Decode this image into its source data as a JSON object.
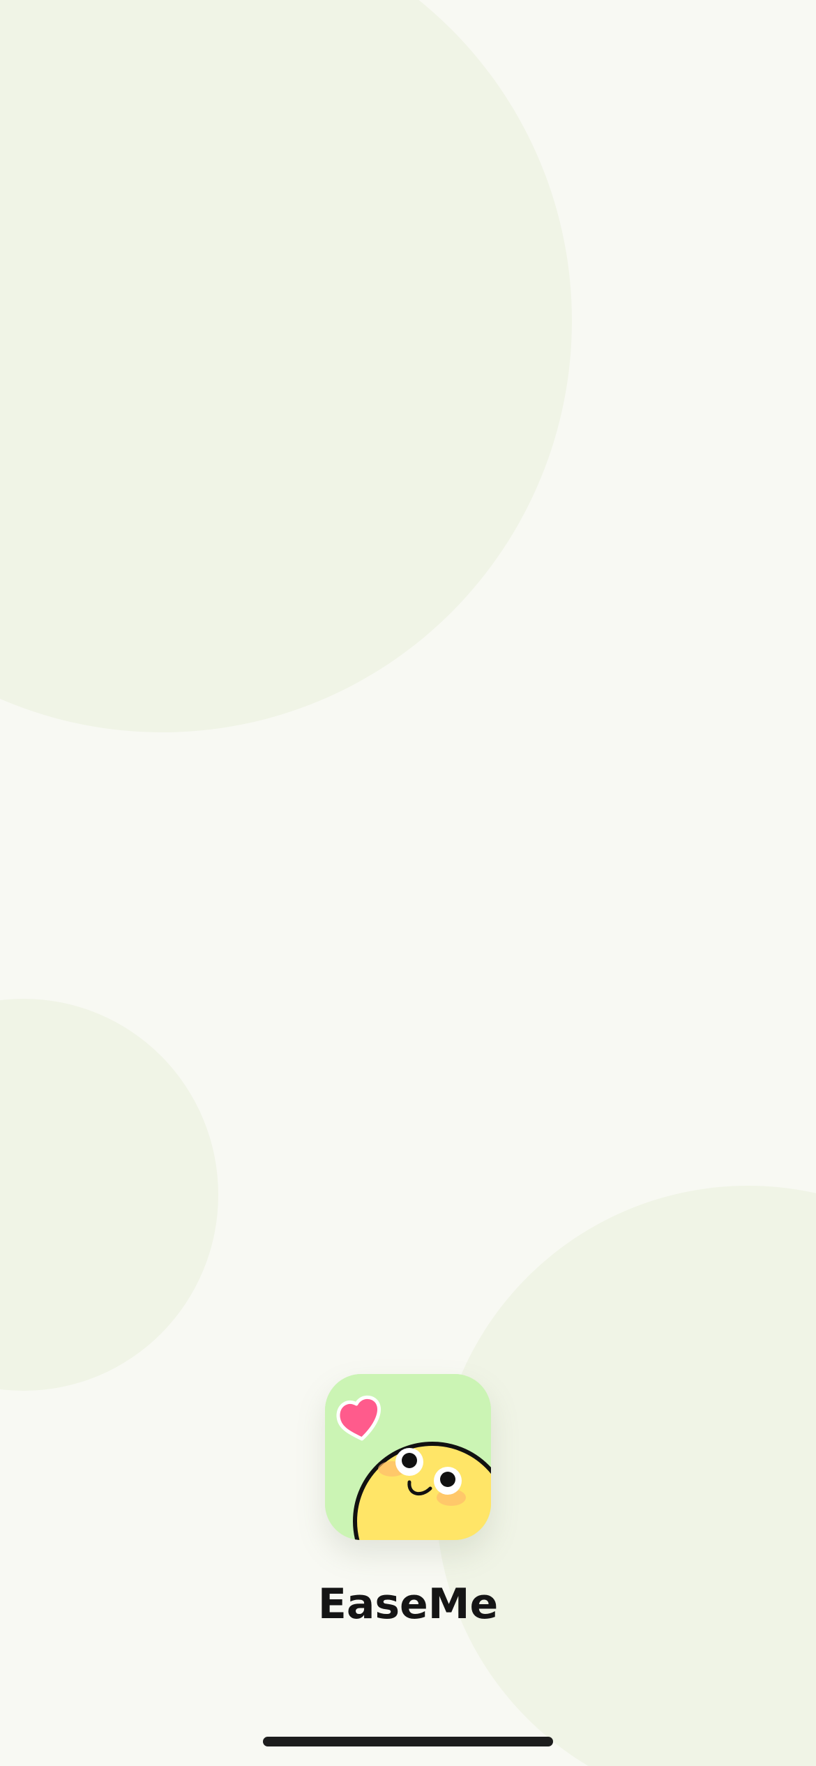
{
  "app": {
    "name": "EaseMe"
  },
  "icons": {
    "app_icon": "easeme-app-icon",
    "heart": "heart-icon",
    "mascot": "smiling-face-icon"
  },
  "colors": {
    "background": "#f8f9f3",
    "background_circle": "#f0f4e6",
    "icon_background": "#cbf4b4",
    "mascot_yellow": "#ffe567",
    "heart_pink": "#ff5b8c",
    "text": "#151515",
    "home_indicator": "#1d1d1d"
  }
}
